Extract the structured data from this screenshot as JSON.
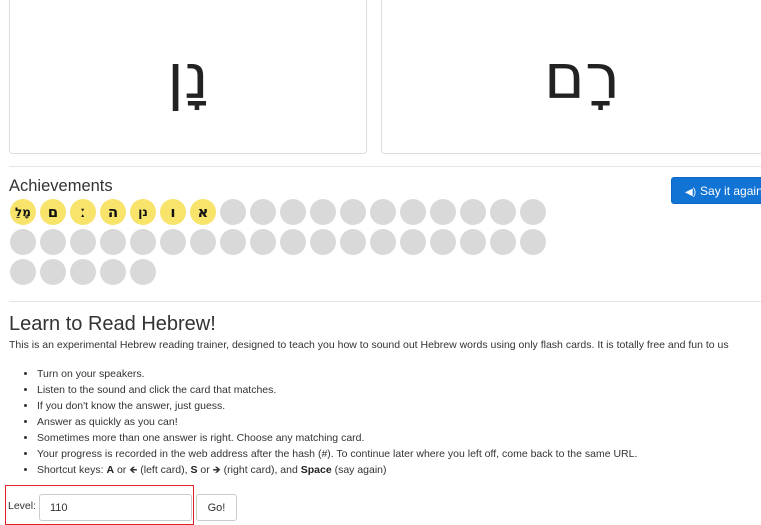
{
  "cards": [
    {
      "glyph": "נָן"
    },
    {
      "glyph": "רָם"
    }
  ],
  "achievements": {
    "title": "Achievements",
    "total_badges": 41,
    "earned": [
      "מָלֵ",
      "ם",
      "ː",
      "ה",
      "נן",
      "ו",
      "א"
    ]
  },
  "say_again": {
    "icon": "speaker-icon",
    "label": "Say it again"
  },
  "lesson": {
    "title": "Learn to Read Hebrew!",
    "intro": "This is an experimental Hebrew reading trainer, designed to teach you how to sound out Hebrew words using only flash cards. It is totally free and fun to us",
    "tips": {
      "t1": "Turn on your speakers.",
      "t2": "Listen to the sound and click the card that matches.",
      "t3": "If you don't know the answer, just guess.",
      "t4": "Answer as quickly as you can!",
      "t5": "Sometimes more than one answer is right. Choose any matching card.",
      "t6": "Your progress is recorded in the web address after the hash (#). To continue later where you left off, come back to the same URL.",
      "t7": {
        "prefix": "Shortcut keys: ",
        "key_a": "A",
        "or1": " or ",
        "left_arrow": "🡸",
        "left_text": " (left card), ",
        "key_s": "S",
        "or2": " or ",
        "right_arrow": "🡺",
        "right_text": " (right card), and ",
        "key_space": "Space",
        "space_text": " (say again)"
      }
    }
  },
  "level": {
    "label": "Level:",
    "value": "110",
    "go": "Go!"
  },
  "colors": {
    "primary": "#1173d4",
    "badge_earned": "#f8e36b",
    "badge_empty": "#d9d9d9",
    "highlight": "#e0232b"
  }
}
